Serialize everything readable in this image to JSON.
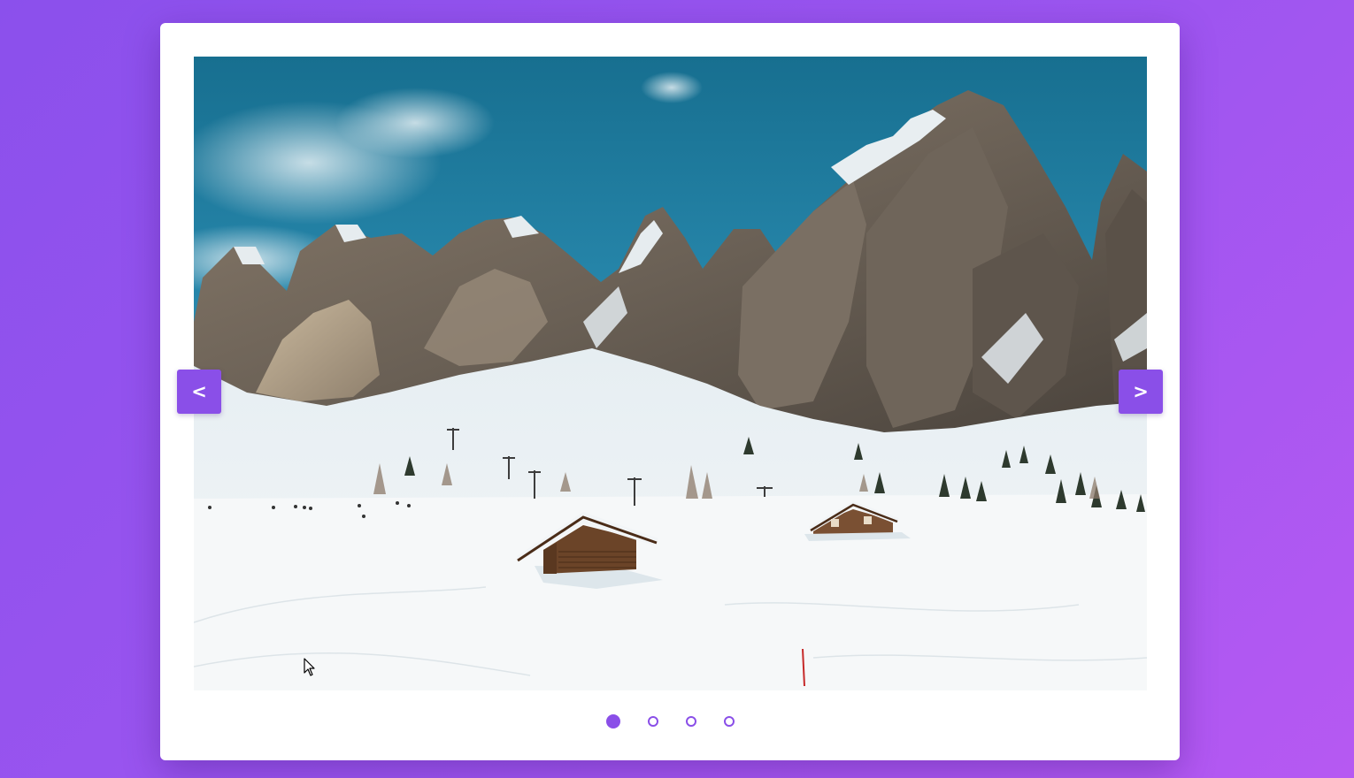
{
  "slider": {
    "prev_label": "<",
    "next_label": ">",
    "slide_count": 4,
    "active_slide": 1,
    "current_slide_image": "snowy-mountain-landscape-with-wooden-cabins",
    "accent_color": "#8a4fe8"
  }
}
